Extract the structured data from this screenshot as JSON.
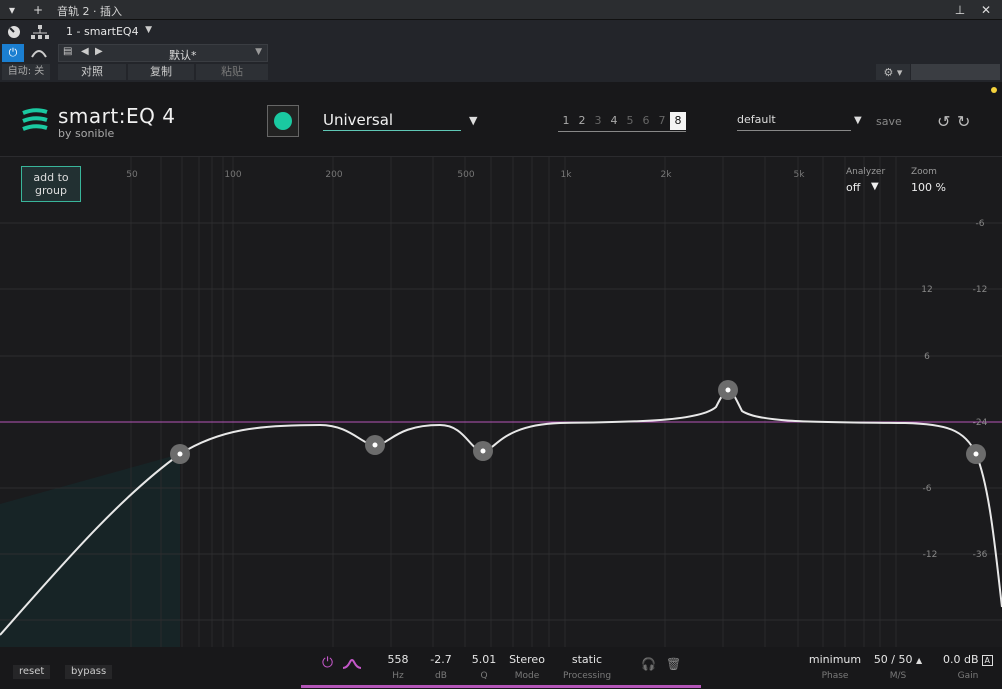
{
  "window": {
    "title": "音轨 2 · 插入",
    "plugin_slot": "1 - smartEQ4",
    "preset_name": "默认*",
    "buttons": {
      "auto": "自动: 关",
      "compare": "对照",
      "copy": "复制",
      "paste": "粘贴"
    }
  },
  "plugin": {
    "brand": "smart:EQ 4",
    "brand_by": "by sonible",
    "profile": "Universal",
    "slots": [
      "1",
      "2",
      "3",
      "4",
      "5",
      "6",
      "7",
      "8"
    ],
    "active_slot": "8",
    "preset": "default",
    "save_label": "save",
    "add_to_group_line1": "add to",
    "add_to_group_line2": "group",
    "analyzer_label": "Analyzer",
    "analyzer_value": "off",
    "zoom_label": "Zoom",
    "zoom_value": "100 %",
    "accent_color": "#1ac9a1",
    "band_color": "#b456b8"
  },
  "freq_labels": [
    "50",
    "100",
    "200",
    "500",
    "1k",
    "2k",
    "5k"
  ],
  "db_labels_left": [
    "12",
    "6",
    "-6",
    "-12"
  ],
  "db_labels_right": [
    "-6",
    "-12",
    "-24",
    "-36"
  ],
  "footer": {
    "reset": "reset",
    "bypass": "bypass",
    "hz": {
      "value": "558",
      "label": "Hz"
    },
    "db": {
      "value": "-2.7",
      "label": "dB"
    },
    "q": {
      "value": "5.01",
      "label": "Q"
    },
    "mode": {
      "value": "Stereo",
      "label": "Mode"
    },
    "processing": {
      "value": "static",
      "label": "Processing"
    },
    "phase": {
      "value": "minimum",
      "label": "Phase"
    },
    "ms": {
      "value": "50 / 50",
      "label": "M/S"
    },
    "gain": {
      "value": "0.0 dB",
      "label": "Gain",
      "auto": "A"
    }
  }
}
